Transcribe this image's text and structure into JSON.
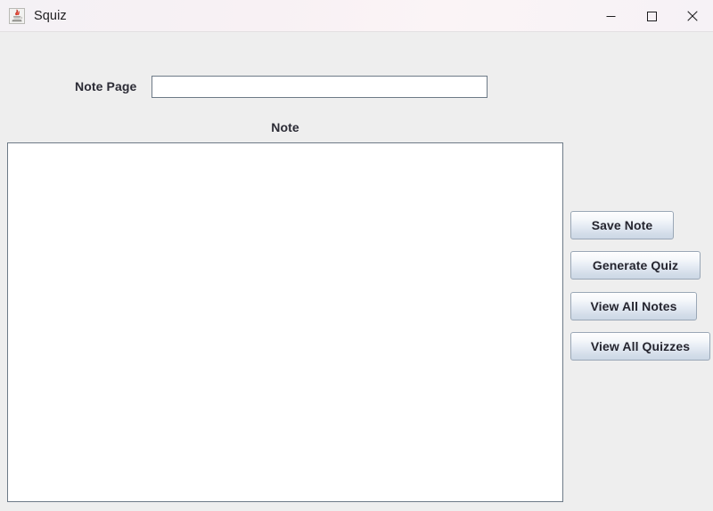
{
  "window": {
    "title": "Squiz",
    "app_icon": "java-coffee-cup-icon",
    "controls": {
      "minimize_label": "—",
      "maximize_label": "☐",
      "close_label": "✕",
      "minimize_name": "minimize-button",
      "maximize_name": "maximize-button",
      "close_name": "close-button"
    },
    "colors": {
      "titlebar_start": "#f4f1f5",
      "titlebar_end": "#f6f2f6",
      "client_background": "#eeeeee",
      "field_border": "#6d7a87",
      "button_border": "#9aa7b6",
      "button_gradient_top": "#fdfdfe",
      "button_gradient_bottom": "#ccd7e5",
      "text_color": "#2b2b35"
    }
  },
  "form": {
    "note_page": {
      "label": "Note Page",
      "value": "",
      "placeholder": ""
    },
    "note": {
      "heading": "Note",
      "value": "",
      "placeholder": ""
    }
  },
  "actions": {
    "save_note": "Save Note",
    "generate_quiz": "Generate Quiz",
    "view_all_notes": "View All Notes",
    "view_all_quizzes": "View All Quizzes"
  }
}
